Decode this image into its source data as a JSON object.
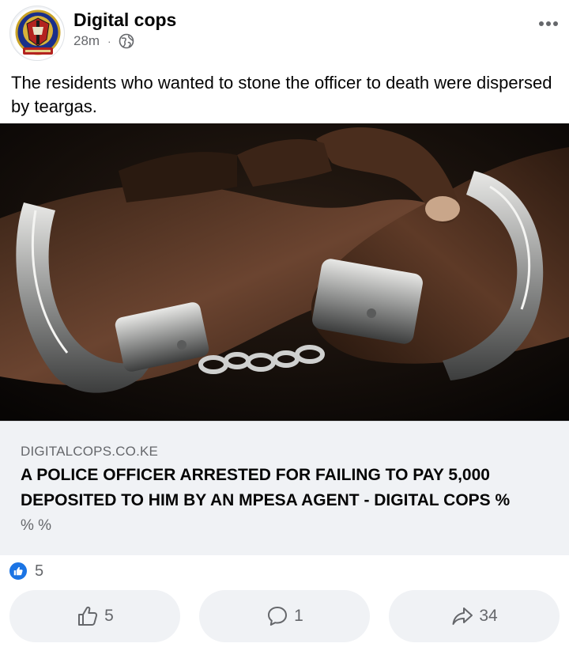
{
  "post": {
    "page_name": "Digital cops",
    "time": "28m",
    "separator": "·",
    "privacy_icon": "globe-icon",
    "text": "The residents who wanted to stone the officer to death were dispersed by teargas."
  },
  "link_preview": {
    "domain": "DIGITALCOPS.CO.KE",
    "title": "A POLICE OFFICER ARRESTED FOR FAILING TO PAY 5,000 DEPOSITED TO HIM BY AN MPESA AGENT - DIGITAL COPS %",
    "subtitle": "% %",
    "image_icon": "handcuffed-hands-photo"
  },
  "reactions": {
    "icon": "like-icon",
    "count": "5"
  },
  "actions": {
    "like": {
      "icon": "thumbs-up-icon",
      "count": "5"
    },
    "comment": {
      "icon": "comment-icon",
      "count": "1"
    },
    "share": {
      "icon": "share-icon",
      "count": "34"
    }
  },
  "colors": {
    "like_blue": "#1b74e4",
    "secondary_text": "#65676b",
    "card_background": "#f0f2f5"
  }
}
